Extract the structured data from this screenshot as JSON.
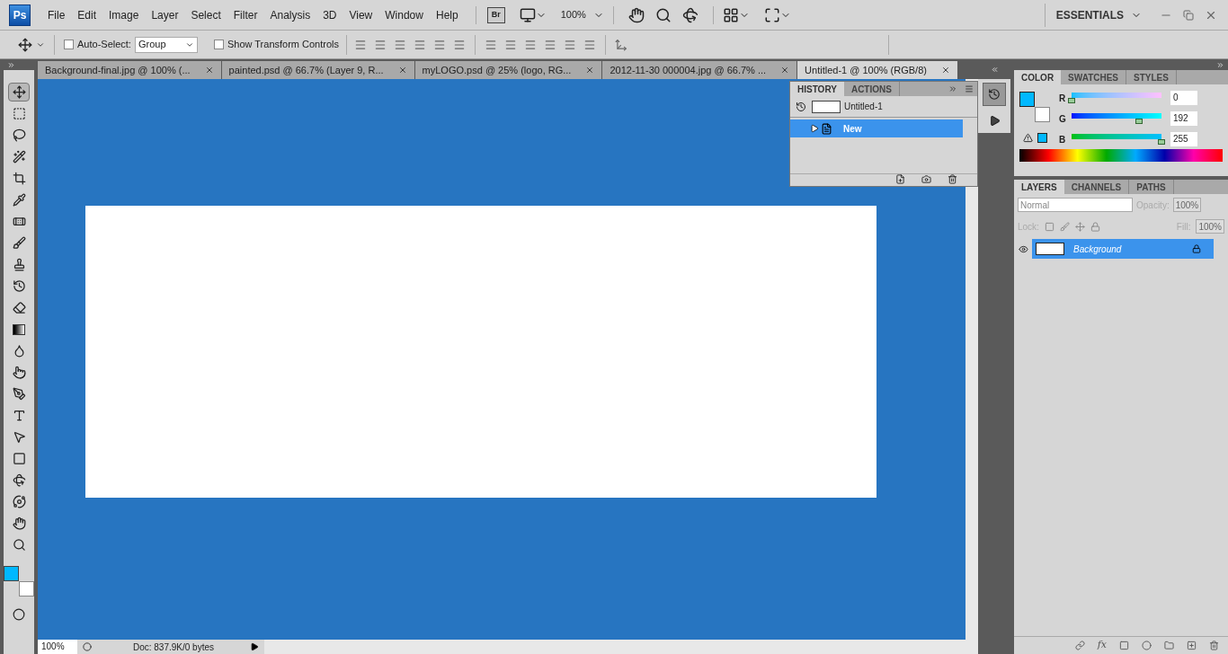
{
  "menu": [
    "File",
    "Edit",
    "Image",
    "Layer",
    "Select",
    "Filter",
    "Analysis",
    "3D",
    "View",
    "Window",
    "Help"
  ],
  "app_bar": {
    "logo": "Ps",
    "bridge": "Br",
    "zoom": "100%",
    "workspace": "ESSENTIALS"
  },
  "options": {
    "auto_select": {
      "label": "Auto-Select:",
      "checked": false
    },
    "auto_select_value": "Group",
    "transform": {
      "label": "Show Transform Controls",
      "checked": false
    }
  },
  "tabs": [
    {
      "label": "Background-final.jpg @ 100% (...",
      "selected": false
    },
    {
      "label": "painted.psd @ 66.7% (Layer 9, R...",
      "selected": false
    },
    {
      "label": "myLOGO.psd @ 25% (logo, RG...",
      "selected": false
    },
    {
      "label": "2012-11-30 000004.jpg @ 66.7% ...",
      "selected": false
    },
    {
      "label": "Untitled-1 @ 100% (RGB/8)",
      "selected": true
    }
  ],
  "tools": [
    {
      "selected": true
    },
    {
      "selected": false
    },
    {
      "selected": false
    },
    {
      "selected": false
    },
    {
      "selected": false
    },
    {
      "selected": false
    },
    {
      "selected": false
    },
    {
      "selected": false
    },
    {
      "selected": false
    },
    {
      "selected": false
    },
    {
      "selected": false
    },
    {
      "selected": false
    },
    {
      "selected": false
    },
    {
      "selected": false
    },
    {
      "selected": false
    },
    {
      "selected": false
    },
    {
      "selected": false
    },
    {
      "selected": false
    },
    {
      "selected": false
    },
    {
      "selected": false
    },
    {
      "selected": false
    },
    {
      "selected": false
    }
  ],
  "history": {
    "tabs": [
      {
        "label": "HISTORY",
        "selected": true
      },
      {
        "label": "ACTIONS",
        "selected": false
      }
    ],
    "snapshot": "Untitled-1",
    "states": [
      {
        "label": "New",
        "selected": true
      }
    ]
  },
  "color_panel": {
    "tabs": [
      {
        "label": "COLOR",
        "selected": true
      },
      {
        "label": "SWATCHES",
        "selected": false
      },
      {
        "label": "STYLES",
        "selected": false
      }
    ],
    "channels": [
      {
        "name": "R",
        "level": 0,
        "reading": "0"
      },
      {
        "name": "G",
        "level": 0.753,
        "reading": "192"
      },
      {
        "name": "B",
        "level": 1,
        "reading": "255"
      }
    ]
  },
  "layers_panel": {
    "tabs": [
      {
        "label": "LAYERS",
        "selected": true
      },
      {
        "label": "CHANNELS",
        "selected": false
      },
      {
        "label": "PATHS",
        "selected": false
      }
    ],
    "blend_mode": "Normal",
    "opacity_label": "Opacity:",
    "opacity": "100%",
    "lock_label": "Lock:",
    "fill_label": "Fill:",
    "fill": "100%",
    "effects_label": "fx",
    "layers": [
      {
        "name": "Background",
        "visible": true,
        "selected": true,
        "locked": true
      }
    ]
  },
  "status_bar": {
    "zoom": "100%",
    "doc": "Doc: 837.9K/0 bytes"
  }
}
